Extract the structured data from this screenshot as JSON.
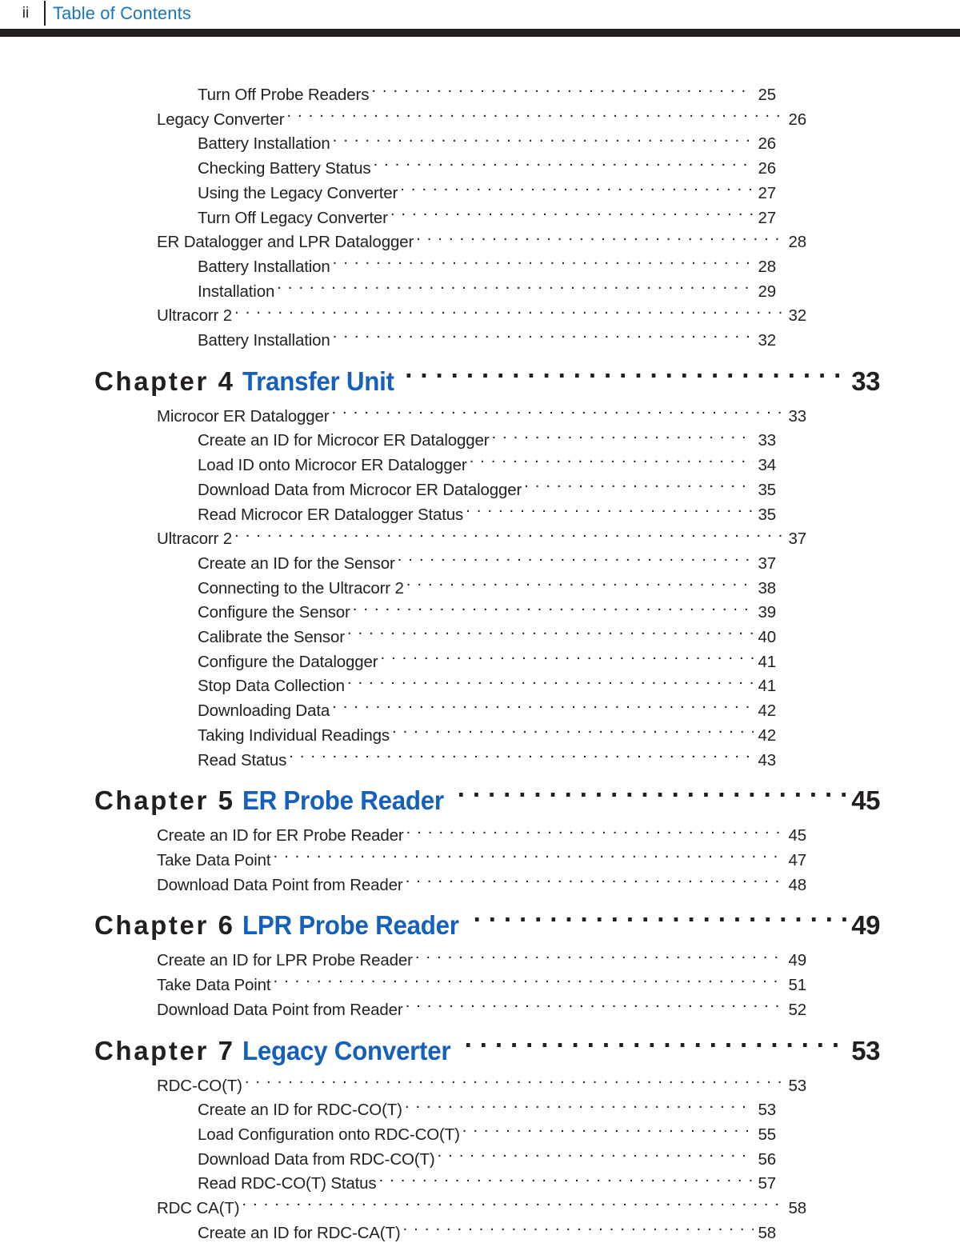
{
  "header": {
    "folio": "ii",
    "title": "Table of Contents",
    "divider_color": "#231f20",
    "bar_color": "#231f20",
    "title_color": "#1b75bc"
  },
  "theme": {
    "chapter_title_color": "#1560bd",
    "text_color": "#231f20",
    "page_background": "#ffffff"
  },
  "toc": {
    "entries": [
      {
        "level": 2,
        "label": "Turn Off Probe Readers",
        "page": "25"
      },
      {
        "level": 1,
        "label": "Legacy Converter",
        "page": "26"
      },
      {
        "level": 2,
        "label": "Battery Installation",
        "page": "26"
      },
      {
        "level": 2,
        "label": "Checking Battery Status",
        "page": "26"
      },
      {
        "level": 2,
        "label": "Using the Legacy Converter",
        "page": "27"
      },
      {
        "level": 2,
        "label": "Turn Off Legacy Converter",
        "page": "27"
      },
      {
        "level": 1,
        "label": "ER Datalogger and LPR Datalogger",
        "page": "28"
      },
      {
        "level": 2,
        "label": "Battery Installation",
        "page": "28"
      },
      {
        "level": 2,
        "label": "Installation",
        "page": "29"
      },
      {
        "level": 1,
        "label": "Ultracorr 2",
        "page": "32"
      },
      {
        "level": 2,
        "label": "Battery Installation",
        "page": "32"
      },
      {
        "level": 0,
        "chapter": "Chapter 4",
        "label": "Transfer Unit",
        "page": "33"
      },
      {
        "level": 1,
        "label": "Microcor ER Datalogger",
        "page": "33"
      },
      {
        "level": 2,
        "label": "Create an ID for Microcor ER Datalogger",
        "page": "33"
      },
      {
        "level": 2,
        "label": "Load ID onto Microcor ER Datalogger",
        "page": "34"
      },
      {
        "level": 2,
        "label": "Download Data from Microcor ER Datalogger",
        "page": "35"
      },
      {
        "level": 2,
        "label": "Read Microcor ER Datalogger Status",
        "page": "35"
      },
      {
        "level": 1,
        "label": "Ultracorr 2",
        "page": "37"
      },
      {
        "level": 2,
        "label": "Create an ID for the Sensor",
        "page": "37"
      },
      {
        "level": 2,
        "label": "Connecting to the Ultracorr 2",
        "page": "38"
      },
      {
        "level": 2,
        "label": "Configure the Sensor",
        "page": "39"
      },
      {
        "level": 2,
        "label": "Calibrate the Sensor",
        "page": "40"
      },
      {
        "level": 2,
        "label": "Configure the Datalogger",
        "page": "41"
      },
      {
        "level": 2,
        "label": "Stop Data Collection",
        "page": "41"
      },
      {
        "level": 2,
        "label": "Downloading Data",
        "page": "42"
      },
      {
        "level": 2,
        "label": "Taking Individual Readings",
        "page": "42"
      },
      {
        "level": 2,
        "label": "Read Status",
        "page": "43"
      },
      {
        "level": 0,
        "chapter": "Chapter 5",
        "label": "ER Probe Reader",
        "page": "45"
      },
      {
        "level": 1,
        "label": "Create an ID for ER Probe Reader",
        "page": "45"
      },
      {
        "level": 1,
        "label": "Take Data Point",
        "page": "47"
      },
      {
        "level": 1,
        "label": "Download Data Point from Reader",
        "page": "48"
      },
      {
        "level": 0,
        "chapter": "Chapter 6",
        "label": "LPR Probe Reader",
        "page": "49"
      },
      {
        "level": 1,
        "label": "Create an ID for LPR Probe Reader",
        "page": "49"
      },
      {
        "level": 1,
        "label": "Take Data Point",
        "page": "51"
      },
      {
        "level": 1,
        "label": "Download Data Point from Reader",
        "page": "52"
      },
      {
        "level": 0,
        "chapter": "Chapter 7",
        "label": "Legacy Converter",
        "page": "53"
      },
      {
        "level": 1,
        "label": "RDC-CO(T)",
        "page": "53"
      },
      {
        "level": 2,
        "label": "Create an ID for RDC-CO(T)",
        "page": "53"
      },
      {
        "level": 2,
        "label": "Load Configuration onto RDC-CO(T)",
        "page": "55"
      },
      {
        "level": 2,
        "label": "Download Data from RDC-CO(T)",
        "page": "56"
      },
      {
        "level": 2,
        "label": "Read RDC-CO(T) Status",
        "page": "57"
      },
      {
        "level": 1,
        "label": "RDC CA(T)",
        "page": "58"
      },
      {
        "level": 2,
        "label": "Create an ID for RDC-CA(T)",
        "page": "58"
      }
    ]
  }
}
